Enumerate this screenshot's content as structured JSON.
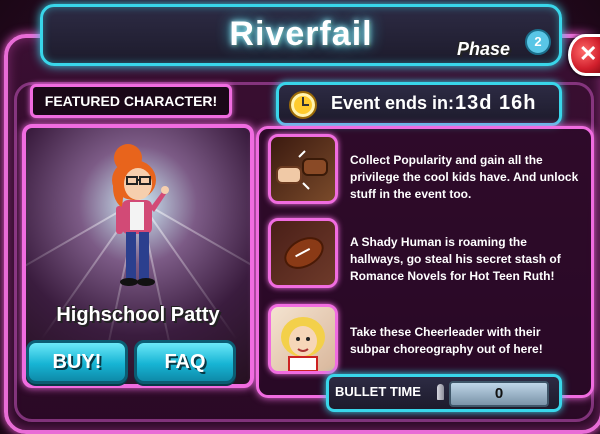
{
  "title": "Riverfail",
  "phase": {
    "label": "Phase",
    "number": "2"
  },
  "featured": {
    "label": "FEATURED CHARACTER!",
    "character_name": "Highschool Patty",
    "buy_label": "BUY!",
    "faq_label": "FAQ"
  },
  "event": {
    "label": "Event ends in:",
    "time": "13d 16h"
  },
  "tasks": [
    {
      "icon": "fist-bump-icon",
      "text": "Collect Popularity and gain all the privilege the cool kids have. And unlock stuff in the event too."
    },
    {
      "icon": "football-icon",
      "text": "A Shady Human is roaming the hallways, go steal his secret stash of Romance Novels for Hot Teen Ruth!"
    },
    {
      "icon": "cheerleader-icon",
      "text": "Take these Cheerleader with their subpar choreography out of here!"
    }
  ],
  "bullet_time": {
    "label": "BULLET TIME",
    "count": "0"
  },
  "colors": {
    "neon_pink": "#f06ce0",
    "neon_cyan": "#39d6ea",
    "button_cyan": "#17b4d4"
  }
}
